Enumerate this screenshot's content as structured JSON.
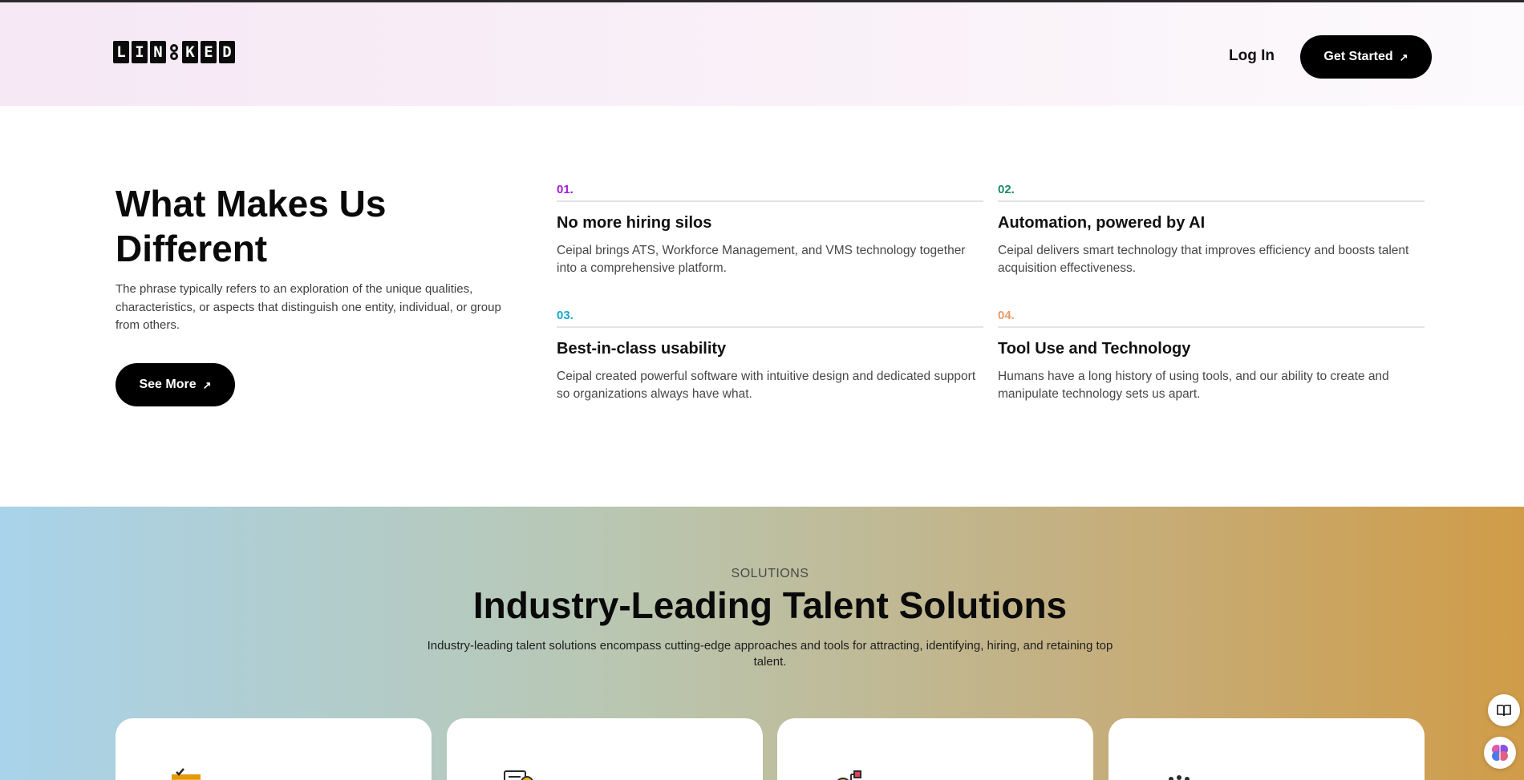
{
  "header": {
    "logo_letters": [
      "L",
      "I",
      "N",
      "K",
      "E",
      "D"
    ],
    "login_label": "Log In",
    "get_started_label": "Get Started"
  },
  "different": {
    "title": "What Makes Us Different",
    "description": "The phrase typically refers to an exploration of the unique qualities, characteristics, or aspects that distinguish one entity, individual, or group from others.",
    "see_more_label": "See More",
    "features": [
      {
        "num": "01.",
        "color": "#a01fd8",
        "title": "No more hiring silos",
        "desc": "Ceipal brings ATS, Workforce Management, and VMS technology together into a comprehensive platform."
      },
      {
        "num": "02.",
        "color": "#1f8a6a",
        "title": "Automation, powered by AI",
        "desc": "Ceipal delivers smart technology that improves efficiency and boosts talent acquisition effectiveness."
      },
      {
        "num": "03.",
        "color": "#1aa6cf",
        "title": "Best-in-class usability",
        "desc": "Ceipal created powerful software with intuitive design and dedicated support so organizations always have what."
      },
      {
        "num": "04.",
        "color": "#e89a6a",
        "title": "Tool Use and Technology",
        "desc": "Humans have a long history of using tools, and our ability to create and manipulate technology sets us apart."
      }
    ]
  },
  "solutions": {
    "eyebrow": "SOLUTIONS",
    "title": "Industry-Leading Talent Solutions",
    "description": "Industry-leading talent solutions encompass cutting-edge approaches and tools for attracting, identifying, hiring, and retaining top talent.",
    "cards": [
      {
        "icon": "task-list-icon"
      },
      {
        "icon": "clipboard-gear-icon"
      },
      {
        "icon": "gear-network-icon"
      },
      {
        "icon": "people-icon"
      }
    ]
  },
  "widgets": {
    "book_icon": "book-icon",
    "brain_icon": "brain-icon"
  }
}
